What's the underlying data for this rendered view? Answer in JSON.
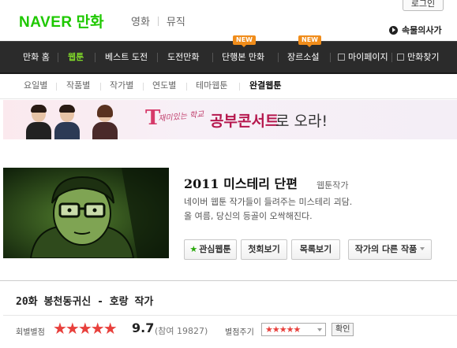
{
  "header": {
    "logo_naver": "NAVER",
    "logo_manhwa": "만화",
    "service_links": [
      "영화",
      "뮤직"
    ],
    "login": "로그인",
    "sokmul": "속물의사가"
  },
  "nav": {
    "items": [
      "만화 홈",
      "웹툰",
      "베스트 도전",
      "도전만화",
      "단행본 만화",
      "장르소설",
      "마이페이지",
      "만화찾기"
    ],
    "new_badge": "NEW"
  },
  "subnav": {
    "items": [
      "요일별",
      "작품별",
      "작가별",
      "연도별",
      "테마웹툰",
      "완결웹툰"
    ]
  },
  "banner": {
    "t_letter": "T",
    "script": "재미있는 학교",
    "title": "공부콘서트",
    "tail": "로 오라!"
  },
  "webtoon": {
    "title": "2011 미스테리 단편",
    "author": "웹툰작가",
    "desc_line1": "네이버 웹툰 작가들이 들려주는 미스테리 괴담.",
    "desc_line2": "올 여름, 당신의 등골이 오싹해진다.",
    "buttons": {
      "favorite": "관심웹툰",
      "first": "첫회보기",
      "list": "목록보기",
      "other": "작가의 다른 작품"
    }
  },
  "episode": {
    "title": "20화 봉천동귀신 - 호랑 작가",
    "rating_label": "회별별점",
    "stars": "★★★★★",
    "score": "9.7",
    "participants": "(참여 19827)",
    "give_label": "별점주기",
    "give_value": "★★★★★",
    "confirm": "확인"
  },
  "colors": {
    "naver_green": "#1ec800",
    "nav_active": "#7fd62a",
    "nav_bg": "#2b2b2b",
    "new_badge": "#f08c1a",
    "star_red": "#e8403c"
  }
}
